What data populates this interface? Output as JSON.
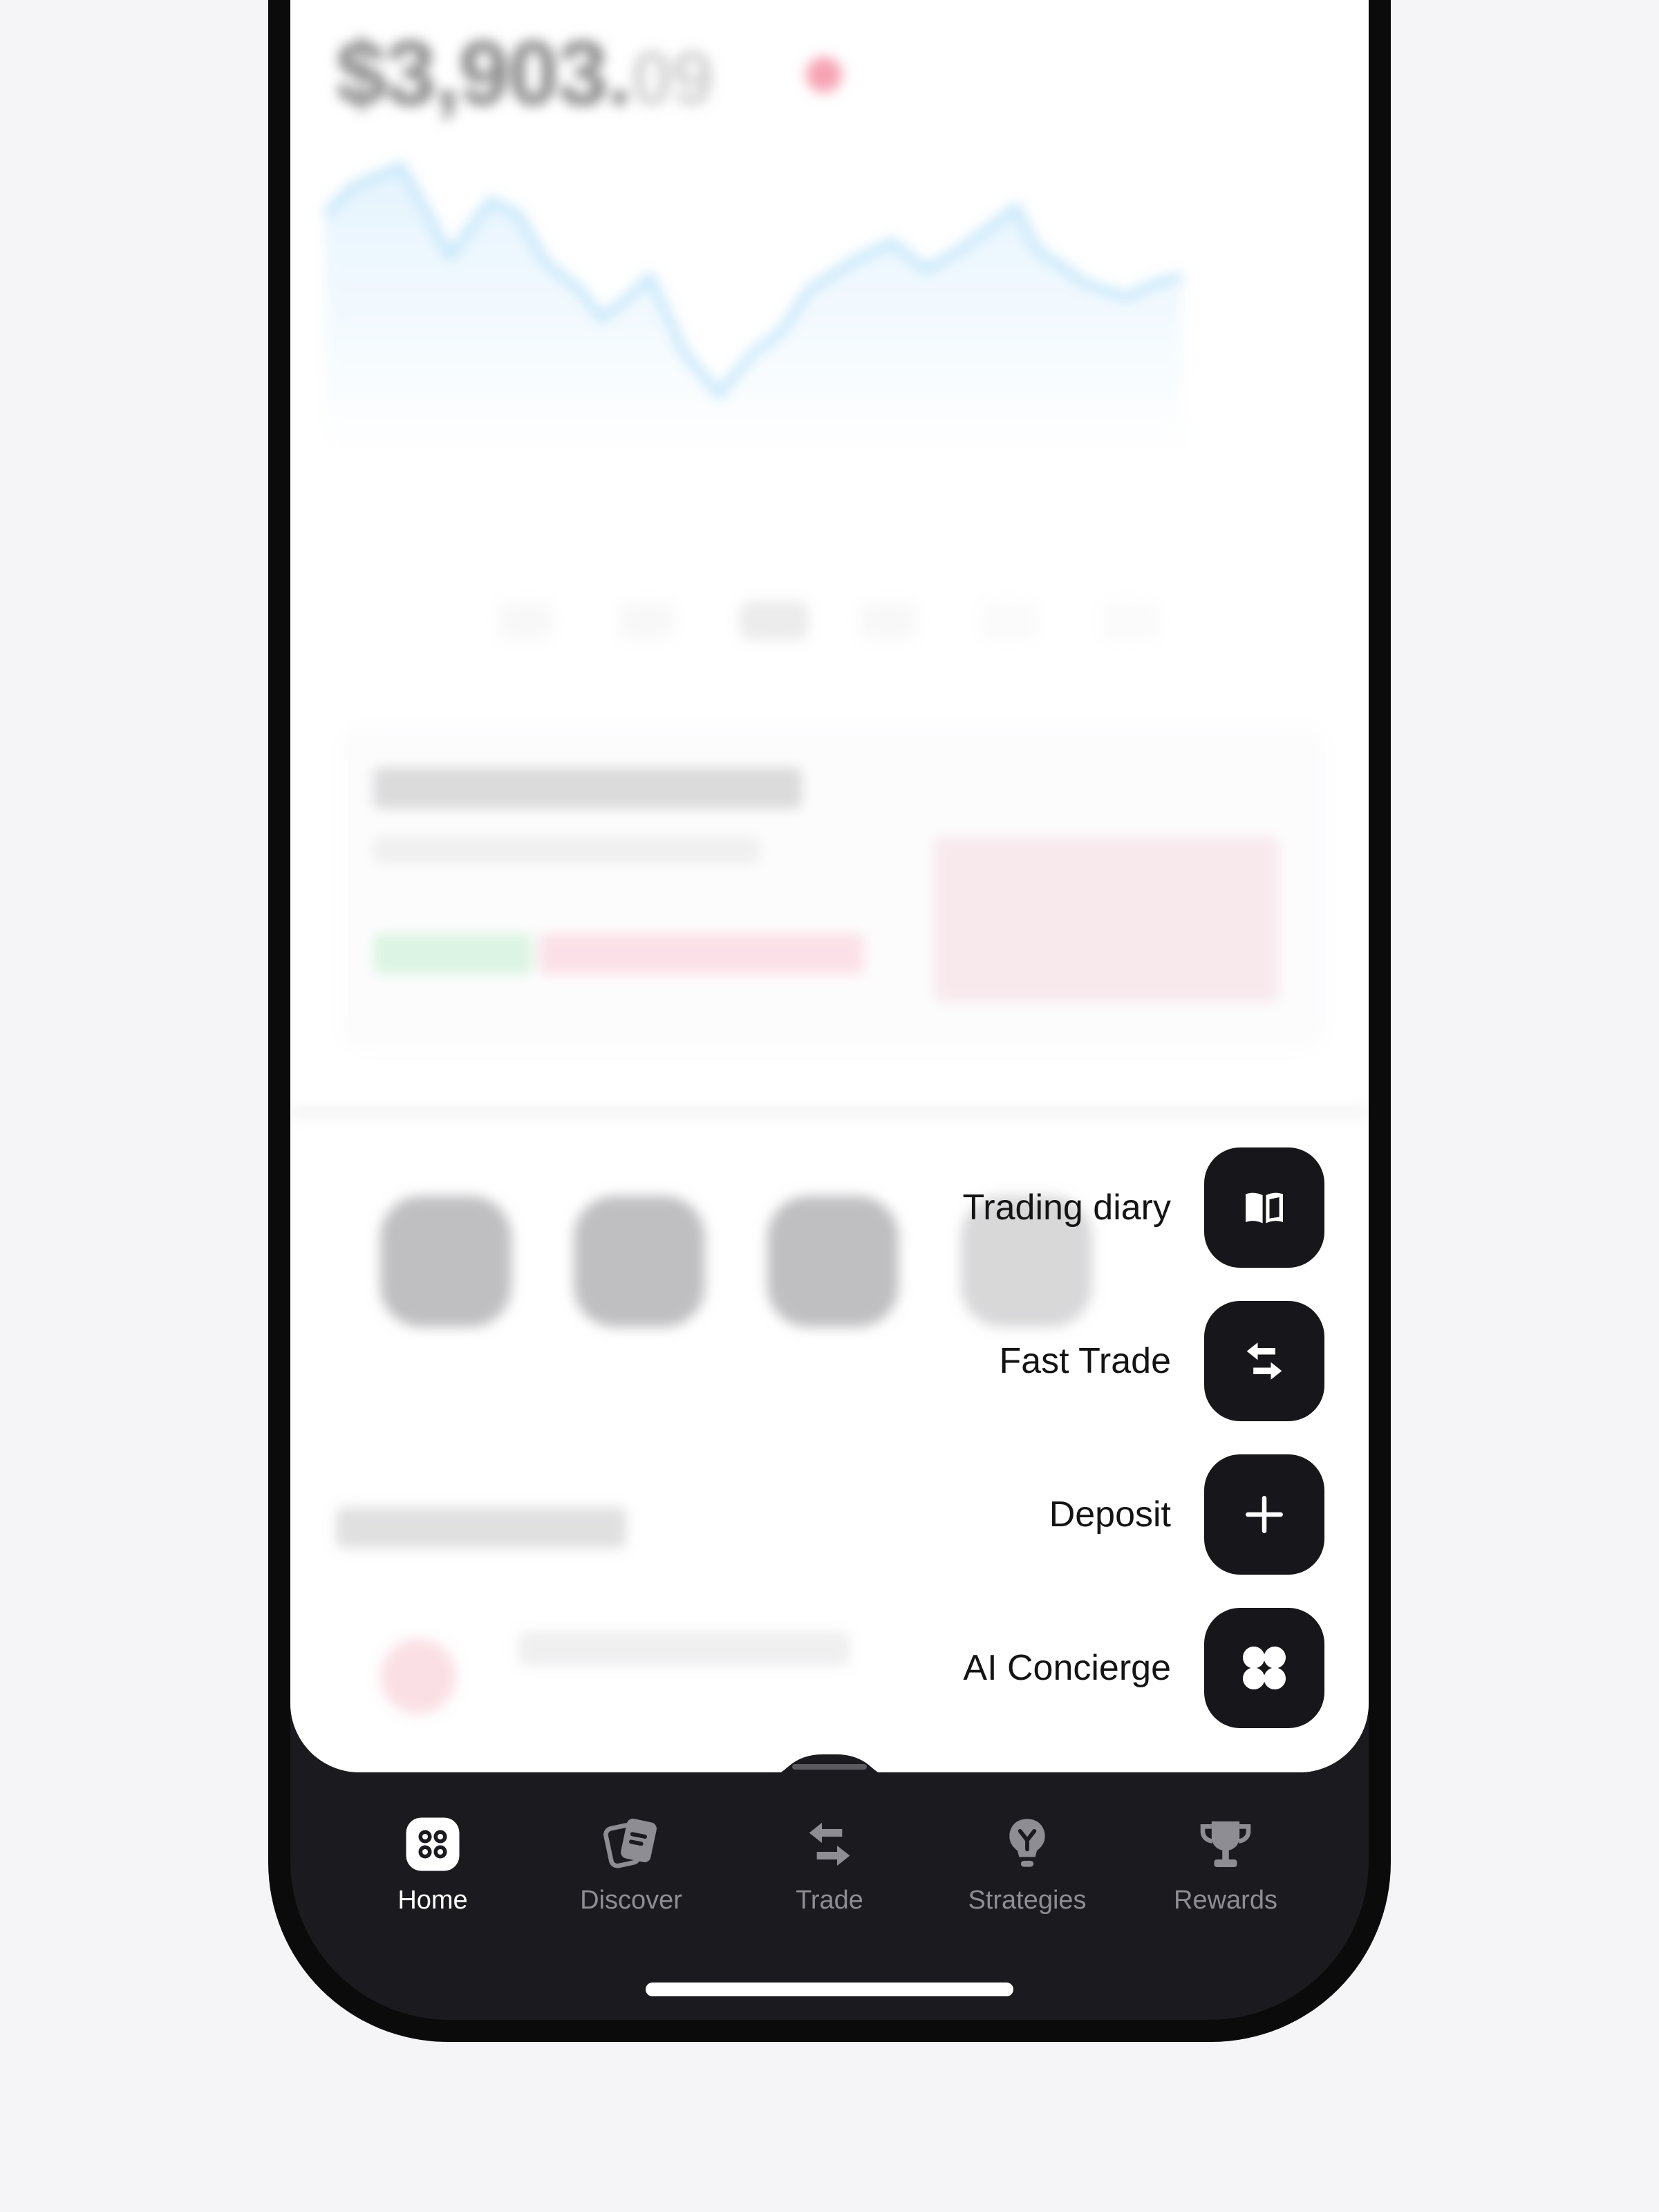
{
  "balance": {
    "whole": "$3,903.",
    "cents": "09"
  },
  "fab_menu": [
    {
      "label": "Trading diary",
      "icon": "book-icon"
    },
    {
      "label": "Fast Trade",
      "icon": "swap-arrows-icon"
    },
    {
      "label": "Deposit",
      "icon": "plus-icon"
    },
    {
      "label": "AI Concierge",
      "icon": "clover-icon"
    }
  ],
  "tabs": [
    {
      "label": "Home",
      "icon": "home-icon",
      "active": true
    },
    {
      "label": "Discover",
      "icon": "cards-icon",
      "active": false
    },
    {
      "label": "Trade",
      "icon": "swap-arrows-icon",
      "active": false
    },
    {
      "label": "Strategies",
      "icon": "lightbulb-icon",
      "active": false
    },
    {
      "label": "Rewards",
      "icon": "trophy-icon",
      "active": false
    }
  ],
  "colors": {
    "accent_dark": "#17161a",
    "negative": "#f05a78",
    "chart_line": "#8fd0f6",
    "tab_inactive": "#8e8d93"
  }
}
